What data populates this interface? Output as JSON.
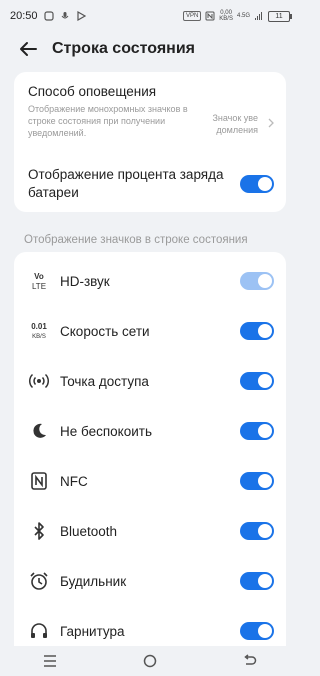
{
  "status_bar": {
    "time": "20:50",
    "vpn": "VPN",
    "net_speed_value": "0,00",
    "net_speed_unit": "KB/S",
    "signal_label": "4.5G",
    "battery": "11"
  },
  "header": {
    "title": "Строка состояния"
  },
  "notification": {
    "title": "Способ оповещения",
    "description": "Отображение монохромных значков в строке состояния при получении уведомлений.",
    "value": "Значок уве домления"
  },
  "battery_percent": {
    "label": "Отображение процента заряда батареи",
    "enabled": true
  },
  "section": {
    "title": "Отображение значков в строке состояния"
  },
  "items": [
    {
      "label": "HD-звук",
      "icon": "volte-icon",
      "enabled": true,
      "disabled": true
    },
    {
      "label": "Скорость сети",
      "icon": "net-speed-icon",
      "enabled": true,
      "disabled": false
    },
    {
      "label": "Точка доступа",
      "icon": "hotspot-icon",
      "enabled": true,
      "disabled": false
    },
    {
      "label": "Не беспокоить",
      "icon": "moon-icon",
      "enabled": true,
      "disabled": false
    },
    {
      "label": "NFC",
      "icon": "nfc-icon",
      "enabled": true,
      "disabled": false
    },
    {
      "label": "Bluetooth",
      "icon": "bluetooth-icon",
      "enabled": true,
      "disabled": false
    },
    {
      "label": "Будильник",
      "icon": "alarm-icon",
      "enabled": true,
      "disabled": false
    },
    {
      "label": "Гарнитура",
      "icon": "headset-icon",
      "enabled": true,
      "disabled": false
    }
  ],
  "icon_text": {
    "volte_top": "Vo",
    "volte_bottom": "LTE",
    "speed_top": "0.01",
    "speed_bottom": "KB/S"
  },
  "colors": {
    "accent": "#1a73e8",
    "accent_disabled": "#9cc2f4",
    "background": "#f0f2f5"
  }
}
